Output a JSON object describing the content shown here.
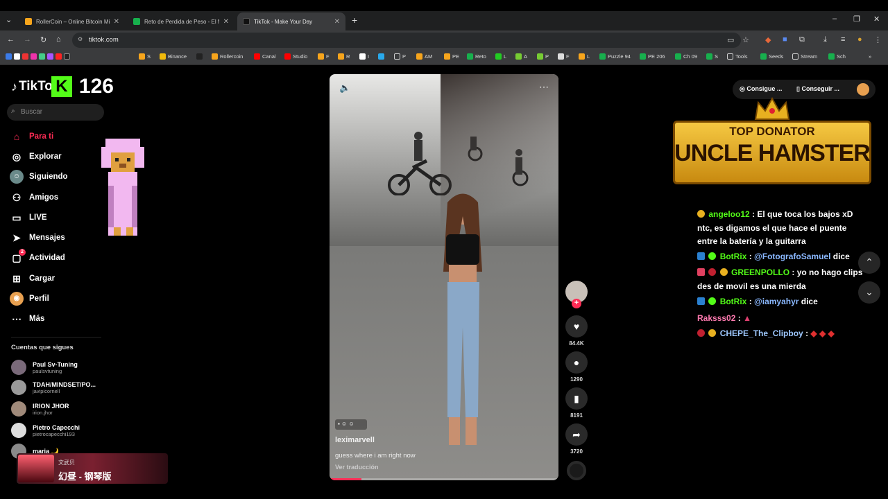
{
  "browser": {
    "tabs": [
      {
        "title": "RollerCoin – Online Bitcoin Min",
        "color": "#f7a51c"
      },
      {
        "title": "Reto de Perdida de Peso - El M",
        "color": "#17b04d"
      },
      {
        "title": "TikTok - Make Your Day",
        "color": "#111111"
      }
    ],
    "url": "tiktok.com",
    "bookmarks": [
      "S",
      "Binance",
      "Rollercoin",
      "Canal",
      "Studio",
      "F",
      "R",
      "I",
      "P",
      "AM",
      "PE",
      "Reto",
      "L",
      "A",
      "P",
      "F",
      "L",
      "Puzzle 94",
      "PE 206",
      "Ch 09",
      "S",
      "Tools",
      "Seeds",
      "Stream",
      "Sch"
    ]
  },
  "overlay": {
    "kick_count": "126"
  },
  "sidebar": {
    "logo_text": "TikTo",
    "search_placeholder": "Buscar",
    "nav": [
      {
        "label": "Para ti",
        "icon": "home-icon"
      },
      {
        "label": "Explorar",
        "icon": "compass-icon"
      },
      {
        "label": "Siguiendo",
        "icon": "following-icon"
      },
      {
        "label": "Amigos",
        "icon": "friends-icon"
      },
      {
        "label": "LIVE",
        "icon": "live-icon"
      },
      {
        "label": "Mensajes",
        "icon": "messages-icon"
      },
      {
        "label": "Actividad",
        "icon": "activity-icon",
        "badge": "2"
      },
      {
        "label": "Cargar",
        "icon": "upload-icon"
      },
      {
        "label": "Perfil",
        "icon": "profile-icon"
      },
      {
        "label": "Más",
        "icon": "more-icon"
      }
    ],
    "following_title": "Cuentas que sigues",
    "following": [
      {
        "name": "Paul Sv-Tuning",
        "handle": "paulsvtuning"
      },
      {
        "name": "TDAH/MINDSET/PO...",
        "handle": "javipicornell"
      },
      {
        "name": "IRION JHOR",
        "handle": "irion.jhor"
      },
      {
        "name": "Pietro Capecchi",
        "handle": "pietrocapecchi193"
      },
      {
        "name": "maria 🌙",
        "handle": ""
      }
    ],
    "music": {
      "artist": "文武贝",
      "title": "幻昼 - 钢琴版"
    }
  },
  "video": {
    "username": "leximarvell",
    "caption": "guess where i am right now",
    "translate": "Ver traducción",
    "progress_fraction": 0.14
  },
  "actions": {
    "likes": "84.4K",
    "comments": "1290",
    "saves": "8191",
    "shares": "3720"
  },
  "top_buttons": {
    "coins": "Consigue ...",
    "app": "Conseguir ..."
  },
  "banner": {
    "line1": "TOP DONATOR",
    "line2": "UNCLE HAMSTER"
  },
  "chat": [
    {
      "user": "angeloo12",
      "user_color": "#53fc18",
      "text": ": El que toca los bajos xD ntc, es digamos el que hace el puente entre la batería y la guitarra"
    },
    {
      "user": "BotRix",
      "user_color": "#53fc18",
      "mention": "@FotografoSamuel",
      "text": " dice"
    },
    {
      "user": "GREENPOLLO",
      "user_color": "#53fc18",
      "text": ": yo no hago clips des de movil es una mierda"
    },
    {
      "user": "BotRix",
      "user_color": "#53fc18",
      "mention": "@iamyahyr",
      "text": " dice"
    },
    {
      "user": "Raksss02",
      "user_color": "#ff7ab0",
      "text": ":"
    },
    {
      "user": "CHEPE_The_Clipboy",
      "user_color": "#9ec8ff",
      "text": ":"
    }
  ]
}
